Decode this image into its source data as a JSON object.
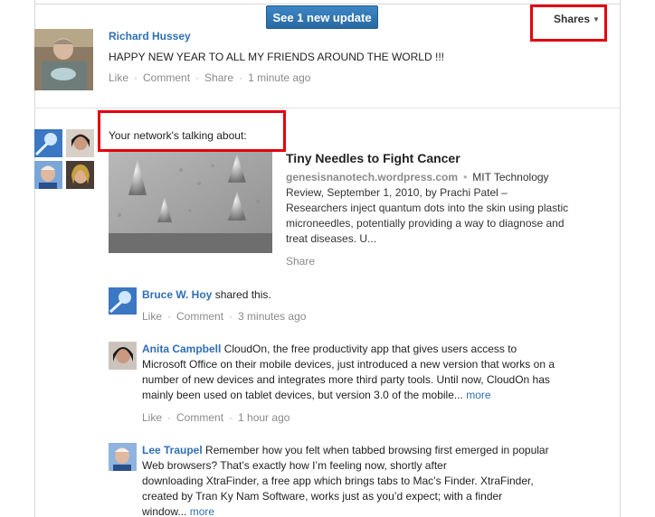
{
  "header": {
    "new_update_label": "See 1 new update",
    "shares_label": "Shares"
  },
  "post": {
    "author": "Richard Hussey",
    "text": "HAPPY NEW YEAR TO ALL MY FRIENDS AROUND THE WORLD !!!",
    "actions": {
      "like": "Like",
      "comment": "Comment",
      "share": "Share",
      "time": "1 minute ago"
    }
  },
  "network": {
    "heading": "Your network's talking about:",
    "article": {
      "title": "Tiny Needles to Fight Cancer",
      "source": "genesisnanotech.wordpress.com",
      "desc_lines": [
        "Review, September 1, 2010, by Prachi Patel  –",
        "Researchers inject quantum dots into the skin using plastic",
        "microneedles, potentially providing a way to diagnose and",
        "treat diseases. U..."
      ],
      "desc_first": "MIT Technology",
      "share": "Share"
    },
    "shares": [
      {
        "name": "Bruce W. Hoy",
        "text": " shared this.",
        "like": "Like",
        "comment": "Comment",
        "time": "3 minutes ago"
      },
      {
        "name": "Anita Campbell",
        "lines": [
          "CloudOn, the free productivity app that gives users access to",
          "Microsoft Office on their mobile devices, just introduced a new version that works on a",
          "number of new devices and integrates more third party tools. Until now, CloudOn has",
          "mainly been used on tablet devices, but version 3.0 of the mobile..."
        ],
        "more": "more",
        "like": "Like",
        "comment": "Comment",
        "time": "1 hour ago"
      },
      {
        "name": "Lee Traupel",
        "lines": [
          "Remember how you felt when tabbed browsing first emerged in popular",
          "Web browsers? That’s exactly how I’m feeling now, shortly after",
          "downloading XtraFinder, a free app which brings tabs to Mac’s Finder. XtraFinder,",
          "created by Tran Ky Nam Software, works just as you’d expect; with a finder",
          "window..."
        ],
        "more": "more"
      }
    ]
  },
  "colors": {
    "accent": "#2f6fb5",
    "button": "#2f78b7",
    "highlight": "#e3000f",
    "meta": "#8a8a8a"
  }
}
